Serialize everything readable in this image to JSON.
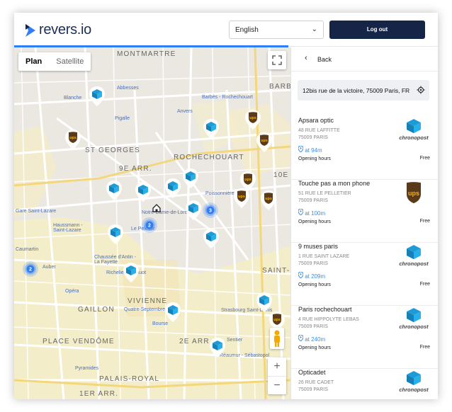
{
  "header": {
    "brand": "revers.io",
    "language": "English",
    "logout_label": "Log out"
  },
  "map": {
    "tabs": [
      {
        "label": "Plan",
        "active": true
      },
      {
        "label": "Satellite",
        "active": false
      }
    ],
    "zoom_in": "+",
    "zoom_out": "−",
    "labels": {
      "montmartre": "MONTMARTRE",
      "abbesses": "Abbesses",
      "blanche": "Blanche",
      "pigalle": "Pigalle",
      "anvers": "Anvers",
      "barbes": "Barbès - Rochechouart",
      "st_georges": "ST GEORGES",
      "rochechouart": "ROCHECHOUART",
      "arr9": "9E ARR.",
      "poissonniere": "Poissonnière",
      "gare_st_lazare": "Gare Saint-Lazare",
      "haussmann": "Haussmann - Saint-Lazare",
      "caumartin": "Caumartin",
      "auber": "Auber",
      "chaussee": "Chaussée d'Antin - La Fayette",
      "richelieu": "Richelieu - Drouot",
      "opera": "Opéra",
      "gaillon": "GAILLON",
      "vivienne": "VIVIENNE",
      "quatre_sept": "Quatre-Septembre",
      "bourse": "Bourse",
      "place_vendome": "PLACE VENDÔME",
      "arr2": "2E ARR.",
      "pyramides": "Pyramides",
      "palais_royal": "PALAIS-ROYAL",
      "arr1": "1ER ARR.",
      "strasbourg": "Strasbourg Saint-Denis",
      "reaumur": "Réaumur - Sébastopol",
      "sentier": "Sentier",
      "saint_denis": "SAINT-D",
      "bourse_label": "BARB",
      "arr10": "10E",
      "notre_dame_lorette": "Notre-Dame-de-Lorette",
      "le_peletier": "Le Peletier"
    },
    "clusters": [
      "2",
      "3",
      "2"
    ]
  },
  "panel": {
    "back_label": "Back",
    "address": "12bis rue de la victoire, 75009 Paris, FR",
    "items": [
      {
        "name": "Apsara optic",
        "street": "48 RUE LAFFITTE",
        "city": "75009 PARIS",
        "distance": "at 94m",
        "hours": "Opening hours",
        "price": "Free",
        "carrier": "chronopost"
      },
      {
        "name": "Touche pas a mon phone",
        "street": "51 RUE LE PELLETIER",
        "city": "75009 PARIS",
        "distance": "at 100m",
        "hours": "Opening hours",
        "price": "Free",
        "carrier": "ups"
      },
      {
        "name": "9 muses paris",
        "street": "1 RUE SAINT LAZARE",
        "city": "75009 PARIS",
        "distance": "at 209m",
        "hours": "Opening hours",
        "price": "Free",
        "carrier": "chronopost"
      },
      {
        "name": "Paris rochechouart",
        "street": "4 RUE HIPPOLYTE LEBAS",
        "city": "75009 PARIS",
        "distance": "at 240m",
        "hours": "Opening hours",
        "price": "Free",
        "carrier": "chronopost"
      },
      {
        "name": "Opticadet",
        "street": "26 RUE CADET",
        "city": "75009 PARIS",
        "distance": "",
        "hours": "",
        "price": "",
        "carrier": "chronopost"
      }
    ],
    "carrier_text": {
      "chronopost": "chronopost",
      "ups": "ups"
    }
  },
  "colors": {
    "accent": "#2f7ef5",
    "navy": "#152447",
    "chronopost_blue": "#1d9bd7",
    "ups_brown": "#5b3a1a",
    "ups_gold": "#f4b400",
    "map_yellow": "#f6edc4"
  }
}
